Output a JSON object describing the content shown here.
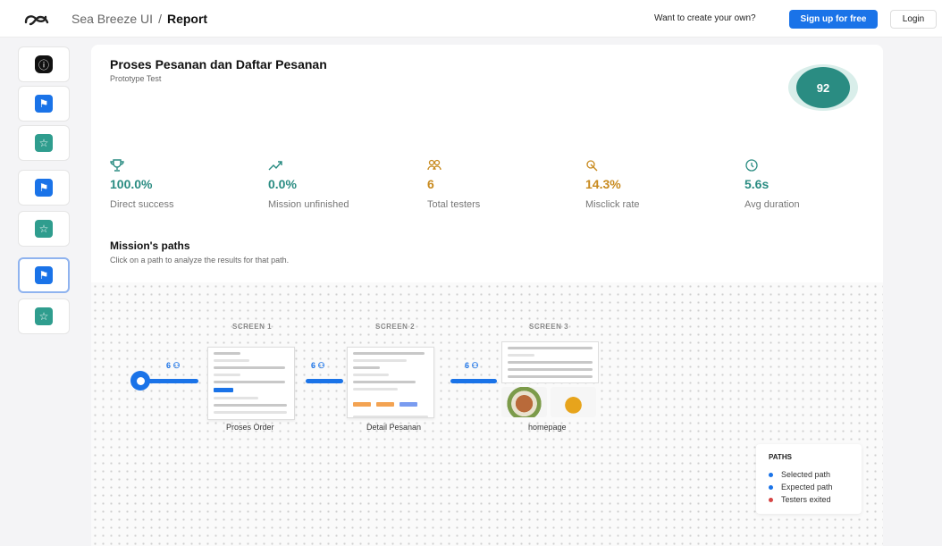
{
  "header": {
    "app_name": "Sea Breeze UI",
    "separator": "/",
    "page": "Report",
    "cta_text": "Want to create your own?",
    "signup_label": "Sign up for free",
    "login_label": "Login"
  },
  "sidebar": {
    "items": [
      {
        "icon": "info-icon",
        "type": "info",
        "glyph": "ⓘ"
      },
      {
        "icon": "flag-icon",
        "type": "flag",
        "glyph": "⚑"
      },
      {
        "icon": "star-icon",
        "type": "star",
        "glyph": "☆"
      },
      {
        "icon": "flag-icon",
        "type": "flag",
        "glyph": "⚑"
      },
      {
        "icon": "star-icon",
        "type": "star",
        "glyph": "☆"
      },
      {
        "icon": "flag-icon",
        "type": "flag",
        "glyph": "⚑",
        "active": true
      },
      {
        "icon": "star-icon",
        "type": "star",
        "glyph": "☆"
      }
    ]
  },
  "report": {
    "title": "Proses Pesanan dan Daftar Pesanan",
    "subtitle": "Prototype Test",
    "score": "92",
    "metrics": [
      {
        "icon": "trophy-icon",
        "value": "100.0%",
        "label": "Direct success",
        "color": "#2a8c82"
      },
      {
        "icon": "chart-icon",
        "value": "0.0%",
        "label": "Mission unfinished",
        "color": "#2a8c82"
      },
      {
        "icon": "users-icon",
        "value": "6",
        "label": "Total testers",
        "color": "#c88a1e"
      },
      {
        "icon": "click-icon",
        "value": "14.3%",
        "label": "Misclick rate",
        "color": "#c88a1e"
      },
      {
        "icon": "clock-icon",
        "value": "5.6s",
        "label": "Avg duration",
        "color": "#2a8c82"
      }
    ]
  },
  "paths": {
    "title": "Mission's paths",
    "subtitle": "Click on a path to analyze the results for that path.",
    "screens": [
      {
        "label": "SCREEN 1",
        "name": "Proses Order"
      },
      {
        "label": "SCREEN 2",
        "name": "Detail Pesanan"
      },
      {
        "label": "SCREEN 3",
        "name": "homepage"
      }
    ],
    "counts": [
      "6 ⚇",
      "6 ⚇",
      "6 ⚇"
    ],
    "legend": {
      "title": "PATHS",
      "items": [
        {
          "label": "Selected path",
          "color": "#1a73e8"
        },
        {
          "label": "Expected path",
          "color": "#1a73e8"
        },
        {
          "label": "Testers exited",
          "color": "#d64545"
        }
      ]
    }
  },
  "colors": {
    "accent": "#1a73e8",
    "teal": "#2a8c82",
    "amber": "#c88a1e"
  }
}
